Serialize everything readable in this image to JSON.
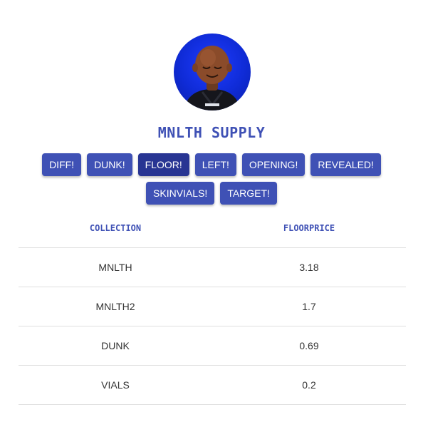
{
  "page": {
    "title": "MNLTH SUPPLY"
  },
  "buttons": [
    {
      "label": "DIFF!"
    },
    {
      "label": "DUNK!"
    },
    {
      "label": "FLOOR!"
    },
    {
      "label": "LEFT!"
    },
    {
      "label": "OPENING!"
    },
    {
      "label": "REVEALED!"
    },
    {
      "label": "SKINVIALS!"
    },
    {
      "label": "TARGET!"
    }
  ],
  "active_button": "FLOOR!",
  "table": {
    "headers": [
      "COLLECTION",
      "FLOORPRICE"
    ],
    "rows": [
      [
        "MNLTH",
        "3.18"
      ],
      [
        "MNLTH2",
        "1.7"
      ],
      [
        "DUNK",
        "0.69"
      ],
      [
        "VIALS",
        "0.2"
      ]
    ]
  },
  "colors": {
    "primary": "#3f51b5",
    "active": "#283593",
    "avatar_background": "#0f2bd6"
  }
}
